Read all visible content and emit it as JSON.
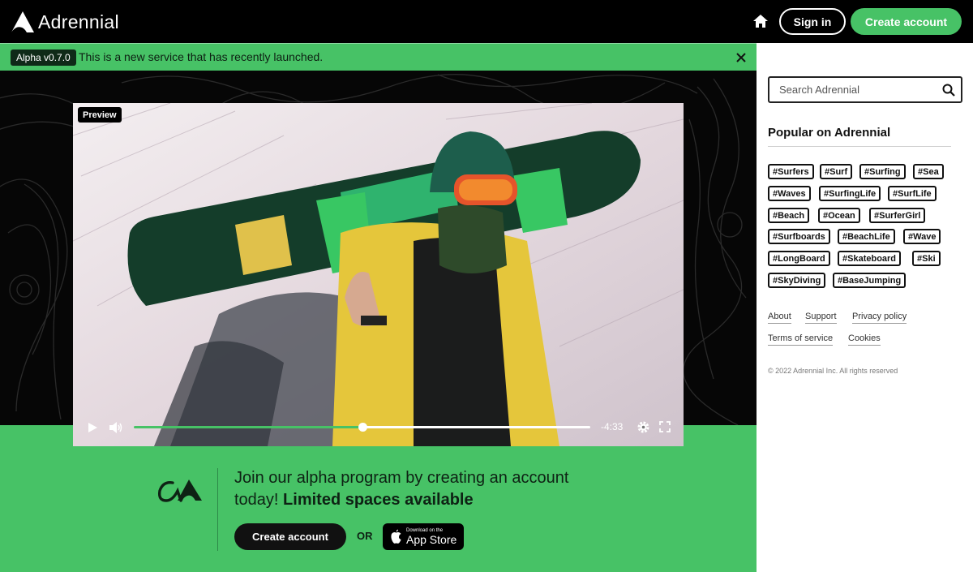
{
  "header": {
    "logo_text": "Adrennial",
    "signin_label": "Sign in",
    "create_account_label": "Create account"
  },
  "banner": {
    "version": "Alpha v0.7.0",
    "message": "This is a new service that has recently launched."
  },
  "video": {
    "preview_label": "Preview",
    "time_remaining": "-4:33",
    "progress": 0.5
  },
  "promo": {
    "text": "Join our alpha program by creating an account today!",
    "text_bold": "Limited spaces available",
    "create_account_label": "Create account",
    "or_label": "OR",
    "appstore_small": "Download on the",
    "appstore_big": "App Store"
  },
  "sidebar": {
    "search_placeholder": "Search Adrennial",
    "popular_title": "Popular on Adrennial",
    "tags": [
      [
        "#Surfers",
        "#Surf",
        "#Surfing",
        "#Sea"
      ],
      [
        "#Waves",
        "#SurfingLife",
        "#SurfLife"
      ],
      [
        "#Beach",
        "#Ocean",
        "#SurferGirl"
      ],
      [
        "#Surfboards",
        "#BeachLife",
        "#Wave"
      ],
      [
        "#LongBoard",
        "#Skateboard",
        "#Ski"
      ],
      [
        "#SkyDiving",
        "#BaseJumping"
      ]
    ],
    "footer_links": [
      "About",
      "Support",
      "Privacy policy",
      "Terms of service",
      "Cookies"
    ],
    "copyright": "© 2022 Adrennial Inc. All rights reserved"
  },
  "colors": {
    "brand_green": "#47c266",
    "header_bg": "#000000"
  }
}
